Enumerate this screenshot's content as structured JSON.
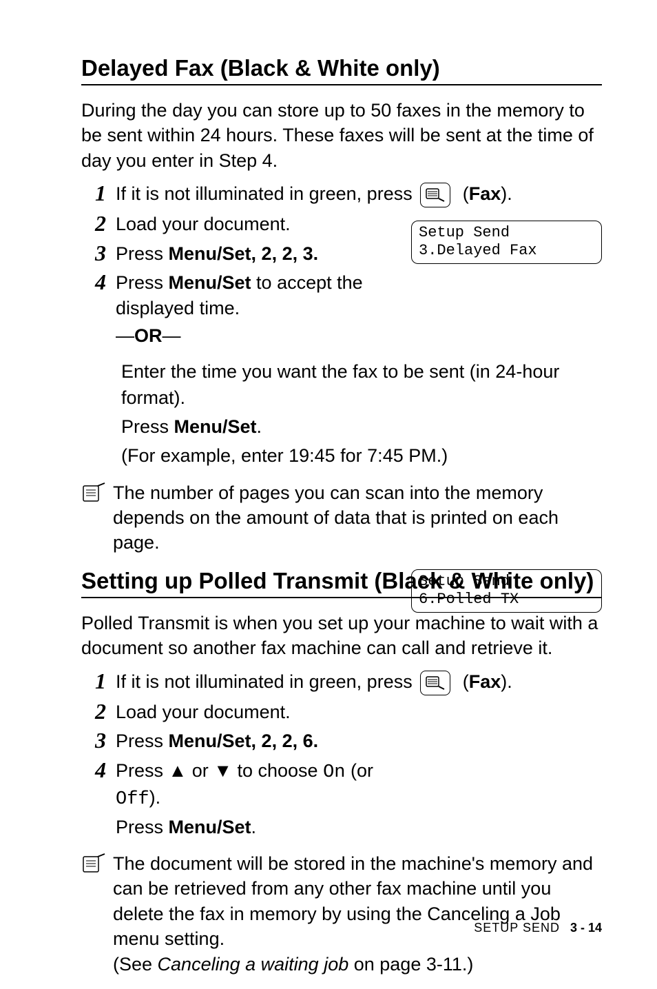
{
  "section1": {
    "heading": "Delayed Fax (Black & White only)",
    "intro": "During the day you can store up to 50 faxes in the memory to be sent within 24 hours. These faxes will be sent at the time of day you enter in Step 4.",
    "steps": {
      "s1_pre": "If it is not illuminated in green, press ",
      "s1_fax": "Fax",
      "s2": "Load your document.",
      "s3_pre": "Press ",
      "s3_key": "Menu/Set",
      "s3_post": ", 2, 2, 3.",
      "s4_pre": "Press ",
      "s4_key": "Menu/Set",
      "s4_post": " to accept the displayed time."
    },
    "or_dash": "—",
    "or_label": "OR",
    "after": {
      "line1": "Enter the time you want the fax to be sent (in 24-hour format).",
      "line2_pre": "Press ",
      "line2_key": "Menu/Set",
      "line2_post": ".",
      "line3": "(For example, enter 19:45 for 7:45 PM.)"
    },
    "display": {
      "line1": "Setup Send",
      "line2": "3.Delayed Fax"
    },
    "note": "The number of pages you can scan into the memory depends on the amount of data that is printed on each page."
  },
  "section2": {
    "heading": "Setting up Polled Transmit (Black & White only)",
    "intro": "Polled Transmit is when you set up your machine to wait with a document so another fax machine can call and retrieve it.",
    "steps": {
      "s1_pre": "If it is not illuminated in green, press ",
      "s1_fax": "Fax",
      "s2": "Load your document.",
      "s3_pre": "Press ",
      "s3_key": "Menu/Set",
      "s3_post": ", 2, 2, 6.",
      "s4_pre": "Press ▲ or ▼ to choose ",
      "s4_on": "On",
      "s4_mid": " (or ",
      "s4_off": "Off",
      "s4_post": ").",
      "s4_line2_pre": "Press ",
      "s4_line2_key": "Menu/Set",
      "s4_line2_post": "."
    },
    "display": {
      "line1": "Setup Send",
      "line2": "6.Polled TX"
    },
    "note_line1": "The document will be stored in the machine's memory and can be retrieved from any other fax machine until you delete the fax in memory by using the Canceling a Job menu setting.",
    "note_line2_pre": "(See ",
    "note_line2_em": "Canceling a waiting job",
    "note_line2_post": " on page 3-11.)"
  },
  "footer": {
    "section": "SETUP SEND",
    "page": "3 - 14"
  }
}
